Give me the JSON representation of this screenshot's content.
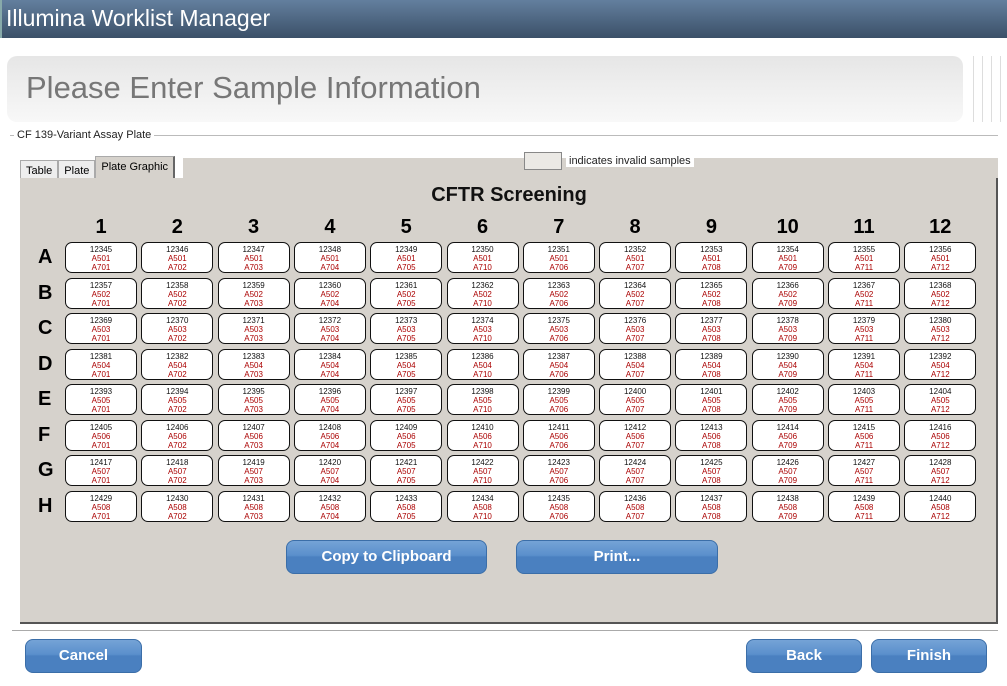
{
  "app_title": "Illumina Worklist Manager",
  "page_heading": "Please Enter Sample Information",
  "group_label": "CF 139-Variant Assay Plate",
  "tabs": [
    {
      "label": "Table"
    },
    {
      "label": "Plate"
    },
    {
      "label": "Plate Graphic",
      "active": true
    }
  ],
  "legend": {
    "text": "indicates invalid samples",
    "swatch_color": "#ebe9e5"
  },
  "plate": {
    "title": "CFTR Screening",
    "columns": [
      "1",
      "2",
      "3",
      "4",
      "5",
      "6",
      "7",
      "8",
      "9",
      "10",
      "11",
      "12"
    ],
    "column_indexes": [
      "A701",
      "A702",
      "A703",
      "A704",
      "A705",
      "A710",
      "A706",
      "A707",
      "A708",
      "A709",
      "A711",
      "A712"
    ],
    "rows": [
      {
        "label": "A",
        "index": "A501",
        "samples": [
          "12345",
          "12346",
          "12347",
          "12348",
          "12349",
          "12350",
          "12351",
          "12352",
          "12353",
          "12354",
          "12355",
          "12356"
        ]
      },
      {
        "label": "B",
        "index": "A502",
        "samples": [
          "12357",
          "12358",
          "12359",
          "12360",
          "12361",
          "12362",
          "12363",
          "12364",
          "12365",
          "12366",
          "12367",
          "12368"
        ]
      },
      {
        "label": "C",
        "index": "A503",
        "samples": [
          "12369",
          "12370",
          "12371",
          "12372",
          "12373",
          "12374",
          "12375",
          "12376",
          "12377",
          "12378",
          "12379",
          "12380"
        ]
      },
      {
        "label": "D",
        "index": "A504",
        "samples": [
          "12381",
          "12382",
          "12383",
          "12384",
          "12385",
          "12386",
          "12387",
          "12388",
          "12389",
          "12390",
          "12391",
          "12392"
        ]
      },
      {
        "label": "E",
        "index": "A505",
        "samples": [
          "12393",
          "12394",
          "12395",
          "12396",
          "12397",
          "12398",
          "12399",
          "12400",
          "12401",
          "12402",
          "12403",
          "12404"
        ]
      },
      {
        "label": "F",
        "index": "A506",
        "samples": [
          "12405",
          "12406",
          "12407",
          "12408",
          "12409",
          "12410",
          "12411",
          "12412",
          "12413",
          "12414",
          "12415",
          "12416"
        ]
      },
      {
        "label": "G",
        "index": "A507",
        "samples": [
          "12417",
          "12418",
          "12419",
          "12420",
          "12421",
          "12422",
          "12423",
          "12424",
          "12425",
          "12426",
          "12427",
          "12428"
        ]
      },
      {
        "label": "H",
        "index": "A508",
        "samples": [
          "12429",
          "12430",
          "12431",
          "12432",
          "12433",
          "12434",
          "12435",
          "12436",
          "12437",
          "12438",
          "12439",
          "12440"
        ]
      }
    ]
  },
  "buttons": {
    "copy": "Copy to Clipboard",
    "print": "Print...",
    "cancel": "Cancel",
    "back": "Back",
    "finish": "Finish"
  },
  "colors": {
    "titlebar": "#4a6382",
    "button": "#4a80c0",
    "panel": "#d6d2cc",
    "index_text": "#aa0000"
  }
}
